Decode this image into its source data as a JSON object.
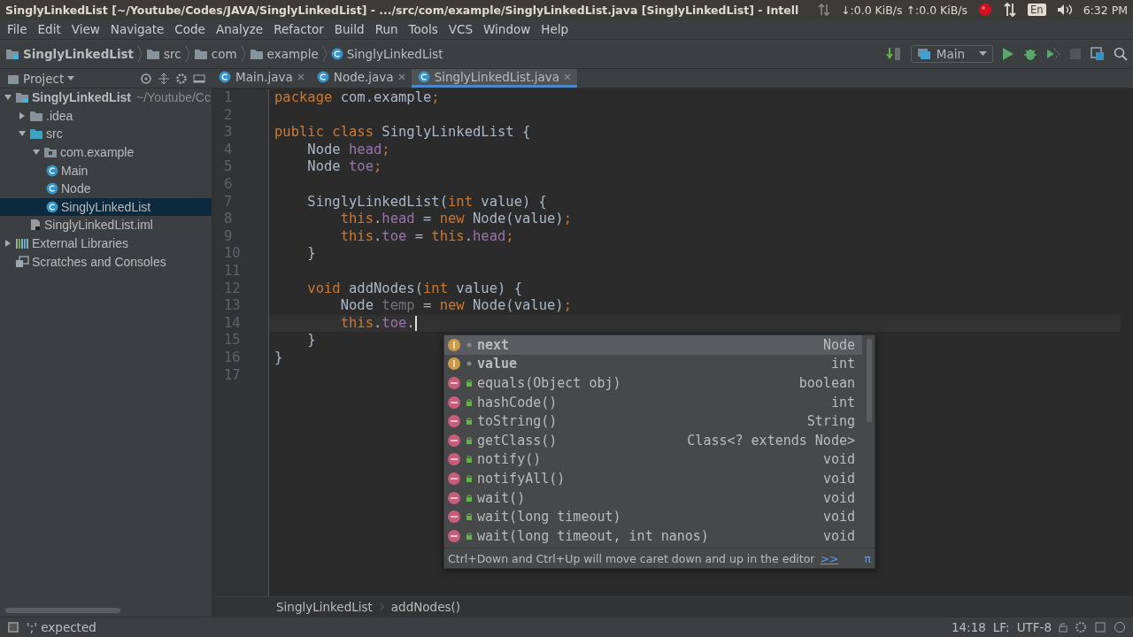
{
  "window": {
    "title": "SinglyLinkedList [~/Youtube/Codes/JAVA/SinglyLinkedList] - .../src/com/example/SinglyLinkedList.java [SinglyLinkedList] - Intell"
  },
  "system_tray": {
    "network": "↓:0.0 KiB/s ↑:0.0 KiB/s",
    "keyboard": "En",
    "clock": "6:32 PM"
  },
  "menu": [
    "File",
    "Edit",
    "View",
    "Navigate",
    "Code",
    "Analyze",
    "Refactor",
    "Build",
    "Run",
    "Tools",
    "VCS",
    "Window",
    "Help"
  ],
  "navigation_bar": {
    "crumbs": [
      {
        "label": "SinglyLinkedList",
        "kind": "module"
      },
      {
        "label": "src",
        "kind": "folder"
      },
      {
        "label": "com",
        "kind": "folder"
      },
      {
        "label": "example",
        "kind": "folder"
      },
      {
        "label": "SinglyLinkedList",
        "kind": "class"
      }
    ],
    "run_config": "Main"
  },
  "project_panel": {
    "title": "Project",
    "tree": [
      {
        "label": "SinglyLinkedList",
        "note": "~/Youtube/Cc",
        "kind": "module",
        "expanded": true,
        "selected": false,
        "children": [
          {
            "label": ".idea",
            "kind": "folder",
            "expanded": false,
            "selected": false
          },
          {
            "label": "src",
            "kind": "source",
            "expanded": true,
            "selected": false,
            "children": [
              {
                "label": "com.example",
                "kind": "package",
                "expanded": true,
                "selected": false,
                "children": [
                  {
                    "label": "Main",
                    "kind": "class",
                    "selected": false
                  },
                  {
                    "label": "Node",
                    "kind": "class",
                    "selected": false
                  },
                  {
                    "label": "SinglyLinkedList",
                    "kind": "class",
                    "selected": true
                  }
                ]
              }
            ]
          },
          {
            "label": "SinglyLinkedList.iml",
            "kind": "file",
            "selected": false
          }
        ]
      },
      {
        "label": "External Libraries",
        "kind": "library",
        "expanded": false,
        "selected": false
      },
      {
        "label": "Scratches and Consoles",
        "kind": "scratches",
        "selected": false
      }
    ]
  },
  "tabs": [
    {
      "label": "Main.java",
      "selected": false
    },
    {
      "label": "Node.java",
      "selected": false
    },
    {
      "label": "SinglyLinkedList.java",
      "selected": true
    }
  ],
  "editor": {
    "lines": [
      {
        "number": "1",
        "current": false,
        "tokens": [
          {
            "text": "package",
            "kind": "keyword"
          },
          {
            "text": " com.example",
            "kind": "plain"
          },
          {
            "text": ";",
            "kind": "keyword"
          }
        ]
      },
      {
        "number": "2"
      },
      {
        "number": "3",
        "current": false,
        "tokens": [
          {
            "text": "public class",
            "kind": "keyword"
          },
          {
            "text": " SinglyLinkedList {",
            "kind": "plain"
          }
        ]
      },
      {
        "number": "4",
        "current": false,
        "tokens": [
          {
            "text": "    Node ",
            "kind": "plain"
          },
          {
            "text": "head",
            "kind": "field"
          },
          {
            "text": ";",
            "kind": "keyword"
          }
        ]
      },
      {
        "number": "5",
        "current": false,
        "tokens": [
          {
            "text": "    Node ",
            "kind": "plain"
          },
          {
            "text": "toe",
            "kind": "field"
          },
          {
            "text": ";",
            "kind": "keyword"
          }
        ]
      },
      {
        "number": "6"
      },
      {
        "number": "7",
        "current": false,
        "tokens": [
          {
            "text": "    SinglyLinkedList(",
            "kind": "plain"
          },
          {
            "text": "int",
            "kind": "keyword"
          },
          {
            "text": " value) {",
            "kind": "plain"
          }
        ]
      },
      {
        "number": "8",
        "current": false,
        "tokens": [
          {
            "text": "        this",
            "kind": "keyword"
          },
          {
            "text": ".",
            "kind": "plain"
          },
          {
            "text": "head",
            "kind": "field"
          },
          {
            "text": " = ",
            "kind": "plain"
          },
          {
            "text": "new",
            "kind": "keyword"
          },
          {
            "text": " Node(value)",
            "kind": "plain"
          },
          {
            "text": ";",
            "kind": "keyword"
          }
        ]
      },
      {
        "number": "9",
        "current": false,
        "tokens": [
          {
            "text": "        this",
            "kind": "keyword"
          },
          {
            "text": ".",
            "kind": "plain"
          },
          {
            "text": "toe",
            "kind": "field"
          },
          {
            "text": " = ",
            "kind": "plain"
          },
          {
            "text": "this",
            "kind": "keyword"
          },
          {
            "text": ".",
            "kind": "plain"
          },
          {
            "text": "head",
            "kind": "field"
          },
          {
            "text": ";",
            "kind": "keyword"
          }
        ]
      },
      {
        "number": "10",
        "current": false,
        "tokens": [
          {
            "text": "    }",
            "kind": "plain"
          }
        ]
      },
      {
        "number": "11"
      },
      {
        "number": "12",
        "current": false,
        "tokens": [
          {
            "text": "    void",
            "kind": "keyword"
          },
          {
            "text": " addNodes(",
            "kind": "plain"
          },
          {
            "text": "int",
            "kind": "keyword"
          },
          {
            "text": " value) {",
            "kind": "plain"
          }
        ]
      },
      {
        "number": "13",
        "current": false,
        "tokens": [
          {
            "text": "        Node ",
            "kind": "plain"
          },
          {
            "text": "temp",
            "kind": "unused"
          },
          {
            "text": " = ",
            "kind": "plain"
          },
          {
            "text": "new",
            "kind": "keyword"
          },
          {
            "text": " Node(value)",
            "kind": "plain"
          },
          {
            "text": ";",
            "kind": "keyword"
          }
        ]
      },
      {
        "number": "14",
        "current": true,
        "tokens": [
          {
            "text": "        this",
            "kind": "keyword"
          },
          {
            "text": ".",
            "kind": "plain"
          },
          {
            "text": "toe",
            "kind": "field"
          },
          {
            "text": ".",
            "kind": "plain"
          }
        ]
      },
      {
        "number": "15",
        "current": false,
        "tokens": [
          {
            "text": "    }",
            "kind": "plain"
          }
        ]
      },
      {
        "number": "16",
        "current": false,
        "tokens": [
          {
            "text": "}",
            "kind": "plain"
          }
        ]
      },
      {
        "number": "17"
      }
    ]
  },
  "completion": {
    "items": [
      {
        "kind": "field",
        "name": "next",
        "type": "Node",
        "selected": true
      },
      {
        "kind": "field",
        "name": "value",
        "type": "int",
        "selected": false
      },
      {
        "kind": "method",
        "name": "equals(Object obj)",
        "type": "boolean",
        "selected": false
      },
      {
        "kind": "method",
        "name": "hashCode()",
        "type": "int",
        "selected": false
      },
      {
        "kind": "method",
        "name": "toString()",
        "type": "String",
        "selected": false
      },
      {
        "kind": "method",
        "name": "getClass()",
        "type": "Class<? extends Node>",
        "selected": false
      },
      {
        "kind": "method",
        "name": "notify()",
        "type": "void",
        "selected": false
      },
      {
        "kind": "method",
        "name": "notifyAll()",
        "type": "void",
        "selected": false
      },
      {
        "kind": "method",
        "name": "wait()",
        "type": "void",
        "selected": false
      },
      {
        "kind": "method",
        "name": "wait(long timeout)",
        "type": "void",
        "selected": false
      },
      {
        "kind": "method",
        "name": "wait(long timeout, int nanos)",
        "type": "void",
        "selected": false
      }
    ],
    "hint": "Ctrl+Down and Ctrl+Up will move caret down and up in the editor",
    "hint_link": ">>",
    "hint_symbol": "π"
  },
  "editor_breadcrumb": [
    "SinglyLinkedList",
    "addNodes()"
  ],
  "status_bar": {
    "message": "';' expected",
    "position": "14:18",
    "line_separator": "LF:",
    "encoding": "UTF-8"
  }
}
